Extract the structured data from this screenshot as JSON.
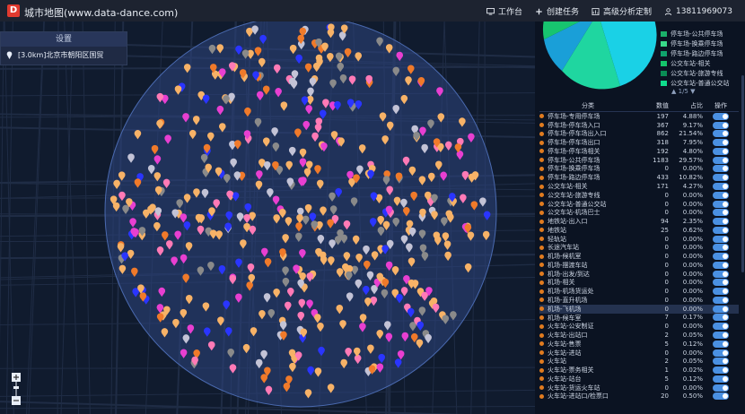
{
  "app": {
    "logo_letter": "D",
    "title": "城市地图(www.data-dance.com)"
  },
  "topnav": [
    {
      "label": "工作台",
      "icon": "monitor-icon"
    },
    {
      "label": "创建任务",
      "icon": "plus-icon"
    },
    {
      "label": "高级分析定制",
      "icon": "chart-icon"
    },
    {
      "label": "13811969073",
      "icon": "user-icon"
    }
  ],
  "sidepanel": {
    "header": "设置",
    "row_label": "[3.0km]北京市朝阳区国贸",
    "row_icon": "location-pin-icon"
  },
  "zoom": {
    "plus": "+",
    "minus": "−"
  },
  "legend": [
    {
      "label": "停车场-公共停车场",
      "color": "#1bb06a"
    },
    {
      "label": "停车场-换乘停车场",
      "color": "#39d98a"
    },
    {
      "label": "停车场-路边停车场",
      "color": "#0fa36c"
    },
    {
      "label": "公交车站-相关",
      "color": "#14c46b"
    },
    {
      "label": "公交车站-旅游专线",
      "color": "#0a8c55"
    },
    {
      "label": "公交车站-普通公交站",
      "color": "#0fdc8c"
    }
  ],
  "pager": "1/5",
  "table": {
    "headers": {
      "category": "分类",
      "count": "数值",
      "ratio": "占比",
      "op": "操作"
    },
    "rows": [
      {
        "name": "停车场-专用停车场",
        "count": "197",
        "ratio": "4.88%"
      },
      {
        "name": "停车场-停车场入口",
        "count": "367",
        "ratio": "9.17%"
      },
      {
        "name": "停车场-停车场出入口",
        "count": "862",
        "ratio": "21.54%"
      },
      {
        "name": "停车场-停车场出口",
        "count": "318",
        "ratio": "7.95%"
      },
      {
        "name": "停车场-停车场相关",
        "count": "192",
        "ratio": "4.80%"
      },
      {
        "name": "停车场-公共停车场",
        "count": "1183",
        "ratio": "29.57%"
      },
      {
        "name": "停车场-换乘停车场",
        "count": "0",
        "ratio": "0.00%"
      },
      {
        "name": "停车场-路边停车场",
        "count": "433",
        "ratio": "10.82%"
      },
      {
        "name": "公交车站-相关",
        "count": "171",
        "ratio": "4.27%"
      },
      {
        "name": "公交车站-旅游专线",
        "count": "0",
        "ratio": "0.00%"
      },
      {
        "name": "公交车站-普通公交站",
        "count": "0",
        "ratio": "0.00%"
      },
      {
        "name": "公交车站-机场巴士",
        "count": "0",
        "ratio": "0.00%"
      },
      {
        "name": "地铁站-出入口",
        "count": "94",
        "ratio": "2.35%"
      },
      {
        "name": "地铁站",
        "count": "25",
        "ratio": "0.62%"
      },
      {
        "name": "轻轨站",
        "count": "0",
        "ratio": "0.00%"
      },
      {
        "name": "长途汽车站",
        "count": "0",
        "ratio": "0.00%"
      },
      {
        "name": "机场-候机室",
        "count": "0",
        "ratio": "0.00%"
      },
      {
        "name": "机场-摆渡车站",
        "count": "0",
        "ratio": "0.00%"
      },
      {
        "name": "机场-出发/到达",
        "count": "0",
        "ratio": "0.00%"
      },
      {
        "name": "机场-相关",
        "count": "0",
        "ratio": "0.00%"
      },
      {
        "name": "机场-机场货运处",
        "count": "0",
        "ratio": "0.00%"
      },
      {
        "name": "机场-直升机场",
        "count": "0",
        "ratio": "0.00%"
      },
      {
        "name": "机场-飞机场",
        "count": "0",
        "ratio": "0.00%"
      },
      {
        "name": "机场-候车室",
        "count": "7",
        "ratio": "0.17%"
      },
      {
        "name": "火车站-公安制证",
        "count": "0",
        "ratio": "0.00%"
      },
      {
        "name": "火车站-出站口",
        "count": "2",
        "ratio": "0.05%"
      },
      {
        "name": "火车站-售票",
        "count": "5",
        "ratio": "0.12%"
      },
      {
        "name": "火车站-进站",
        "count": "0",
        "ratio": "0.00%"
      },
      {
        "name": "火车站",
        "count": "2",
        "ratio": "0.05%"
      },
      {
        "name": "火车站-票务相关",
        "count": "1",
        "ratio": "0.02%"
      },
      {
        "name": "火车站-站台",
        "count": "5",
        "ratio": "0.12%"
      },
      {
        "name": "火车站-货运火车站",
        "count": "0",
        "ratio": "0.00%"
      },
      {
        "name": "火车站-进站口/检票口",
        "count": "20",
        "ratio": "0.50%"
      }
    ]
  },
  "colors": {
    "accent": "#4a90e2",
    "category_dot": "#e07b1f",
    "circle": "#2e4680"
  }
}
